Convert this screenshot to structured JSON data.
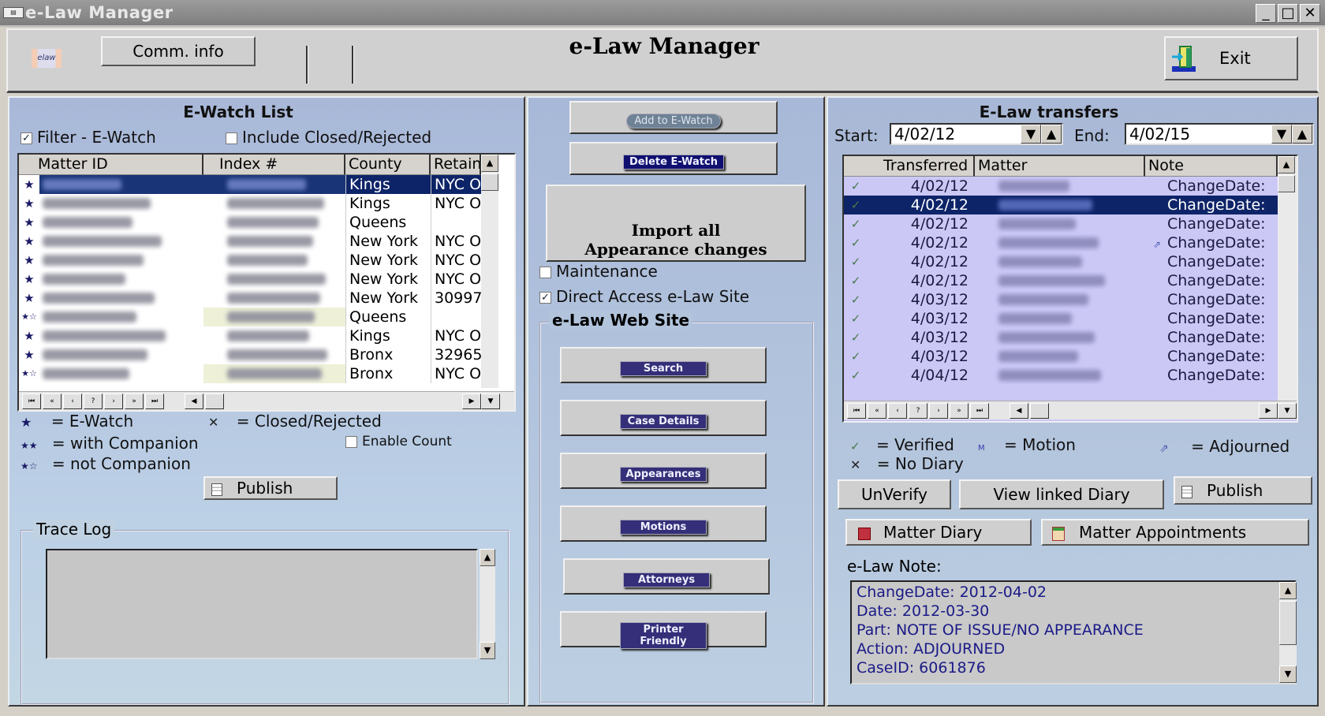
{
  "window": {
    "title": "e-Law Manager",
    "icon": "app-icon",
    "controls": {
      "minimize": "_",
      "maximize": "□",
      "close": "✕"
    }
  },
  "header": {
    "logo_text": "elaw",
    "comm_info_label": "Comm. info",
    "heading": "e-Law Manager",
    "exit_label": "Exit"
  },
  "ewatch": {
    "title": "E-Watch List",
    "filter_label": "Filter - E-Watch",
    "filter_checked": true,
    "include_closed_label": "Include Closed/Rejected",
    "include_closed_checked": false,
    "columns": [
      "Matter ID",
      "Index #",
      "County",
      "Retain"
    ],
    "rows": [
      {
        "icon": "★",
        "matter": "[redacted]",
        "index": "[redacted]",
        "county": "Kings",
        "retain": "NYC O",
        "selected": true
      },
      {
        "icon": "★",
        "matter": "[redacted]",
        "index": "[redacted]",
        "county": "Kings",
        "retain": "NYC O"
      },
      {
        "icon": "★",
        "matter": "[redacted]",
        "index": "[redacted]",
        "county": "Queens",
        "retain": ""
      },
      {
        "icon": "★",
        "matter": "[redacted]",
        "index": "[redacted]",
        "county": "New York",
        "retain": "NYC O"
      },
      {
        "icon": "★",
        "matter": "[redacted]",
        "index": "[redacted]",
        "county": "New York",
        "retain": "NYC O"
      },
      {
        "icon": "★",
        "matter": "[redacted]",
        "index": "[redacted]",
        "county": "New York",
        "retain": "NYC O"
      },
      {
        "icon": "★",
        "matter": "[redacted]",
        "index": "[redacted]",
        "county": "New York",
        "retain": "30997"
      },
      {
        "icon": "★☆",
        "matter": "[redacted]",
        "index": "[redacted]",
        "county": "Queens",
        "retain": "",
        "highlight": true
      },
      {
        "icon": "★",
        "matter": "[redacted]",
        "index": "[redacted]",
        "county": "Kings",
        "retain": "NYC O"
      },
      {
        "icon": "★",
        "matter": "[redacted]",
        "index": "[redacted]",
        "county": "Bronx",
        "retain": "32965"
      },
      {
        "icon": "★☆",
        "matter": "[redacted]",
        "index": "[redacted]",
        "county": "Bronx",
        "retain": "NYC O",
        "highlight": true
      }
    ],
    "nav_buttons": [
      "⏮",
      "«",
      "‹",
      "?",
      "›",
      "»",
      "⏭"
    ],
    "legend": [
      {
        "icon": "★",
        "label": "= E-Watch"
      },
      {
        "icon": "★★",
        "label": "= with Companion"
      },
      {
        "icon": "★☆",
        "label": "= not Companion"
      },
      {
        "icon": "✕",
        "label": "= Closed/Rejected"
      }
    ],
    "enable_count_label": "Enable Count",
    "enable_count_checked": false,
    "publish_label": "Publish",
    "trace_log_label": "Trace Log",
    "trace_log_value": ""
  },
  "middle": {
    "add_label": "Add to E-Watch",
    "delete_label": "Delete E-Watch",
    "import_label": "Import all Appearance changes",
    "maintenance_label": "Maintenance",
    "maintenance_checked": false,
    "direct_access_label": "Direct Access e-Law Site",
    "direct_access_checked": true,
    "website_group_label": "e-Law Web Site",
    "website_buttons": [
      "Search",
      "Case Details",
      "Appearances",
      "Motions",
      "Attorneys",
      "Printer Friendly"
    ]
  },
  "transfers": {
    "title": "E-Law transfers",
    "start_label": "Start:",
    "start_value": "4/02/12",
    "end_label": "End:",
    "end_value": "4/02/15",
    "columns": [
      "Transferred",
      "Matter",
      "Note"
    ],
    "rows": [
      {
        "status": "✓",
        "date": "4/02/12",
        "matter": "[redacted]",
        "note": "ChangeDate:",
        "flag": ""
      },
      {
        "status": "✓",
        "date": "4/02/12",
        "matter": "[redacted]",
        "note": "ChangeDate:",
        "flag": "",
        "selected": true
      },
      {
        "status": "✓",
        "date": "4/02/12",
        "matter": "[redacted]",
        "note": "ChangeDate:",
        "flag": ""
      },
      {
        "status": "✓",
        "date": "4/02/12",
        "matter": "[redacted]",
        "note": "ChangeDate:",
        "flag": "adjourned"
      },
      {
        "status": "✓",
        "date": "4/02/12",
        "matter": "[redacted]",
        "note": "ChangeDate:",
        "flag": ""
      },
      {
        "status": "✓",
        "date": "4/02/12",
        "matter": "[redacted]",
        "note": "ChangeDate:",
        "flag": ""
      },
      {
        "status": "✓",
        "date": "4/03/12",
        "matter": "[redacted]",
        "note": "ChangeDate:",
        "flag": ""
      },
      {
        "status": "✓",
        "date": "4/03/12",
        "matter": "[redacted]",
        "note": "ChangeDate:",
        "flag": ""
      },
      {
        "status": "✓",
        "date": "4/03/12",
        "matter": "[redacted]",
        "note": "ChangeDate:",
        "flag": ""
      },
      {
        "status": "✓",
        "date": "4/03/12",
        "matter": "[redacted]",
        "note": "ChangeDate:",
        "flag": ""
      },
      {
        "status": "✓",
        "date": "4/04/12",
        "matter": "[redacted]",
        "note": "ChangeDate:",
        "flag": ""
      }
    ],
    "legend": [
      {
        "icon": "✓",
        "label": "= Verified"
      },
      {
        "icon": "M",
        "label": "= Motion"
      },
      {
        "icon": "⇗",
        "label": "= Adjourned"
      },
      {
        "icon": "✕",
        "label": "= No Diary"
      }
    ],
    "unverify_label": "UnVerify",
    "view_diary_label": "View linked Diary",
    "publish_label": "Publish",
    "matter_diary_label": "Matter Diary",
    "matter_appointments_label": "Matter Appointments",
    "note_label": "e-Law Note:",
    "note_lines": [
      "ChangeDate: 2012-04-02",
      "Date: 2012-03-30",
      "Part: NOTE OF ISSUE/NO APPEARANCE",
      "Action: ADJOURNED",
      "CaseID: 6061876"
    ]
  },
  "colors": {
    "selection": "#0e2468",
    "panel_bg": "#b8cce0",
    "pill_button": "#342f78",
    "note_text": "#1a1a88"
  }
}
